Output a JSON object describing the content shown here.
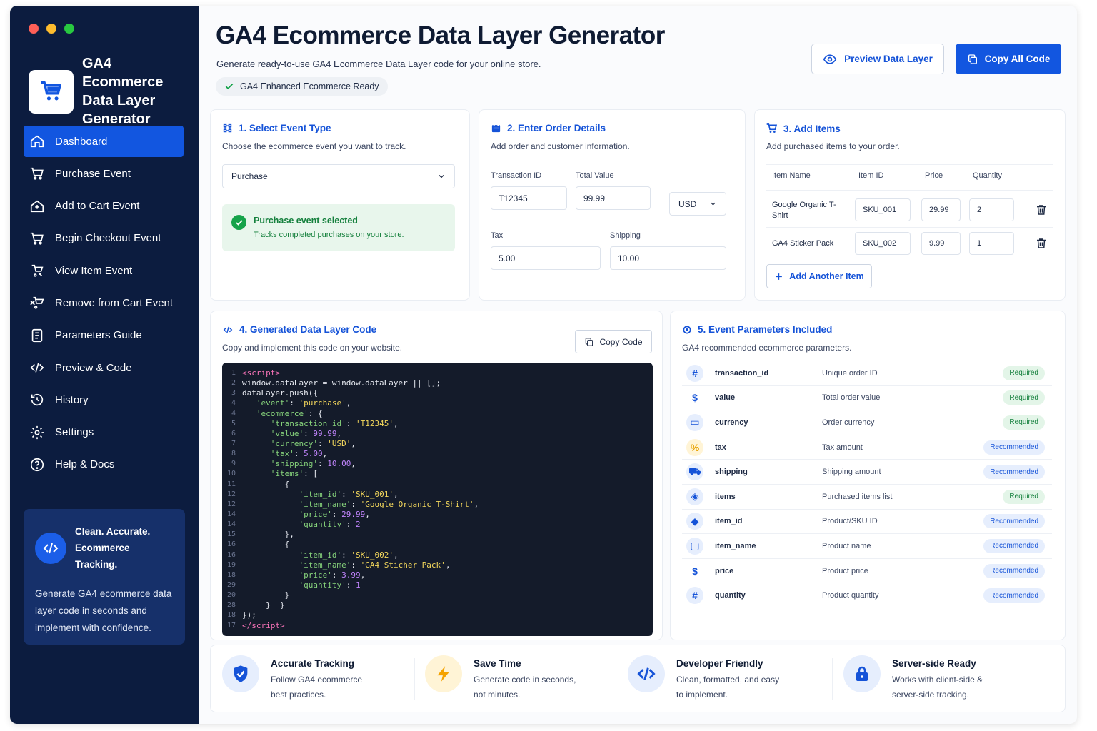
{
  "sidebar": {
    "brand_title": "GA4 Ecommerce Data Layer Generator",
    "items": [
      {
        "label": "Dashboard",
        "icon": "home-icon"
      },
      {
        "label": "Purchase Event",
        "icon": "cart-icon"
      },
      {
        "label": "Add to Cart Event",
        "icon": "add-cart-icon"
      },
      {
        "label": "Begin Checkout Event",
        "icon": "checkout-cart-icon"
      },
      {
        "label": "View Item Event",
        "icon": "view-item-icon"
      },
      {
        "label": "Remove from Cart Event",
        "icon": "remove-cart-icon"
      },
      {
        "label": "Parameters Guide",
        "icon": "guide-icon"
      },
      {
        "label": "Preview & Code",
        "icon": "code-icon"
      },
      {
        "label": "History",
        "icon": "history-icon"
      },
      {
        "label": "Settings",
        "icon": "gear-icon"
      },
      {
        "label": "Help & Docs",
        "icon": "help-icon"
      }
    ],
    "promo": {
      "title": "Clean. Accurate. Ecommerce Tracking.",
      "text": "Generate GA4 ecommerce data layer code in seconds and implement with confidence."
    }
  },
  "header": {
    "title": "GA4 Ecommerce Data Layer Generator",
    "subtitle": "Generate ready-to-use GA4 Ecommerce Data Layer code for your online store.",
    "pill": "GA4 Enhanced Ecommerce Ready",
    "preview_button": "Preview Data Layer",
    "copy_all_button": "Copy All Code"
  },
  "step1": {
    "title": "1. Select Event Type",
    "desc": "Choose the ecommerce event you want to track.",
    "selected": "Purchase",
    "success_title": "Purchase event selected",
    "success_sub": "Tracks completed purchases on your store."
  },
  "step2": {
    "title": "2. Enter Order Details",
    "desc": "Add order and customer information.",
    "transaction_label": "Transaction ID",
    "transaction_value": "T12345",
    "total_label": "Total Value",
    "total_value": "99.99",
    "currency": "USD",
    "tax_label": "Tax",
    "tax_value": "5.00",
    "shipping_label": "Shipping",
    "shipping_value": "10.00"
  },
  "step3": {
    "title": "3. Add Items",
    "desc": "Add purchased items to your order.",
    "columns": [
      "Item Name",
      "Item ID",
      "Price",
      "Quantity"
    ],
    "items": [
      {
        "name": "Google Organic T-Shirt",
        "id": "SKU_001",
        "price": "29.99",
        "qty": "2"
      },
      {
        "name": "GA4 Sticker Pack",
        "id": "SKU_002",
        "price": "9.99",
        "qty": "1"
      }
    ],
    "add_button": "Add Another Item"
  },
  "step4": {
    "title": "4. Generated Data Layer Code",
    "desc": "Copy and implement this code on your website.",
    "copy_button": "Copy Code",
    "code_lines": [
      {
        "n": "1",
        "html": "<span class='tok-tag'>&lt;script&gt;</span>"
      },
      {
        "n": "2",
        "html": "window.dataLayer = window.dataLayer || [];"
      },
      {
        "n": "3",
        "html": "dataLayer.push({"
      },
      {
        "n": "4",
        "html": "   <span class='tok-key'>'event'</span>: <span class='tok-str'>'purchase'</span>,"
      },
      {
        "n": "4",
        "html": "   <span class='tok-key'>'ecommerce'</span>: {"
      },
      {
        "n": "5",
        "html": "      <span class='tok-key'>'transaction_id'</span>: <span class='tok-str'>'T12345'</span>,"
      },
      {
        "n": "6",
        "html": "      <span class='tok-key'>'value'</span>: <span class='tok-num'>99.99</span>,"
      },
      {
        "n": "7",
        "html": "      <span class='tok-key'>'currency'</span>: <span class='tok-str'>'USD'</span>,"
      },
      {
        "n": "8",
        "html": "      <span class='tok-key'>'tax'</span>: <span class='tok-num'>5.00</span>,"
      },
      {
        "n": "9",
        "html": "      <span class='tok-key'>'shipping'</span>: <span class='tok-num'>10.00</span>,"
      },
      {
        "n": "10",
        "html": "      <span class='tok-key'>'items'</span>: ["
      },
      {
        "n": "11",
        "html": "         {"
      },
      {
        "n": "12",
        "html": "            <span class='tok-key'>'item_id'</span>: <span class='tok-str'>'SKU_001'</span>,"
      },
      {
        "n": "12",
        "html": "            <span class='tok-key'>'item_name'</span>: <span class='tok-str'>'Google Organic T-Shirt'</span>,"
      },
      {
        "n": "14",
        "html": "            <span class='tok-key'>'price'</span>: <span class='tok-num'>29.99</span>,"
      },
      {
        "n": "14",
        "html": "            <span class='tok-key'>'quantity'</span>: <span class='tok-num'>2</span>"
      },
      {
        "n": "15",
        "html": "         },"
      },
      {
        "n": "16",
        "html": "         {"
      },
      {
        "n": "16",
        "html": "            <span class='tok-key'>'item_id'</span>: <span class='tok-str'>'SKU_002'</span>,"
      },
      {
        "n": "19",
        "html": "            <span class='tok-key'>'item_name'</span>: <span class='tok-str'>'GA4 Sticher Pack'</span>,"
      },
      {
        "n": "18",
        "html": "            <span class='tok-key'>'price'</span>: <span class='tok-num'>3.99</span>,"
      },
      {
        "n": "29",
        "html": "            <span class='tok-key'>'quantity'</span>: <span class='tok-num'>1</span>"
      },
      {
        "n": "20",
        "html": "         }"
      },
      {
        "n": "28",
        "html": "     }  }"
      },
      {
        "n": "18",
        "html": "});"
      },
      {
        "n": "17",
        "html": "<span class='tok-tag'>&lt;/script&gt;</span>"
      }
    ]
  },
  "step5": {
    "title": "5. Event Parameters Included",
    "desc": "GA4 recommended ecommerce parameters.",
    "params": [
      {
        "icon": "hash-icon",
        "glyph": "#",
        "name": "transaction_id",
        "desc": "Unique order ID",
        "badge": "Required",
        "type": "req",
        "color": "#e6eefd",
        "fg": "#1553d8"
      },
      {
        "icon": "dollar-icon",
        "glyph": "$",
        "name": "value",
        "desc": "Total order value",
        "badge": "Required",
        "type": "req",
        "color": "#ffffff",
        "fg": "#1553d8"
      },
      {
        "icon": "card-icon",
        "glyph": "▭",
        "name": "currency",
        "desc": "Order currency",
        "badge": "Required",
        "type": "req",
        "color": "#e6eefd",
        "fg": "#1553d8"
      },
      {
        "icon": "percent-icon",
        "glyph": "%",
        "name": "tax",
        "desc": "Tax amount",
        "badge": "Recommended",
        "type": "rec",
        "color": "#fff4d6",
        "fg": "#e8a200"
      },
      {
        "icon": "truck-icon",
        "glyph": "⛟",
        "name": "shipping",
        "desc": "Shipping amount",
        "badge": "Recommended",
        "type": "rec",
        "color": "#e6eefd",
        "fg": "#1553d8"
      },
      {
        "icon": "box-icon",
        "glyph": "◈",
        "name": "items",
        "desc": "Purchased items list",
        "badge": "Required",
        "type": "req",
        "color": "#e6eefd",
        "fg": "#1553d8"
      },
      {
        "icon": "tag-icon",
        "glyph": "◆",
        "name": "item_id",
        "desc": "Product/SKU ID",
        "badge": "Recommended",
        "type": "rec",
        "color": "#e6eefd",
        "fg": "#1553d8"
      },
      {
        "icon": "square-icon",
        "glyph": "▢",
        "name": "item_name",
        "desc": "Product name",
        "badge": "Recommended",
        "type": "rec",
        "color": "#e6eefd",
        "fg": "#1553d8"
      },
      {
        "icon": "dollar-icon",
        "glyph": "$",
        "name": "price",
        "desc": "Product price",
        "badge": "Recommended",
        "type": "rec",
        "color": "#ffffff",
        "fg": "#1553d8"
      },
      {
        "icon": "hash-icon",
        "glyph": "#",
        "name": "quantity",
        "desc": "Product quantity",
        "badge": "Recommended",
        "type": "rec",
        "color": "#e6eefd",
        "fg": "#1553d8"
      }
    ]
  },
  "features": [
    {
      "title": "Accurate Tracking",
      "text": "Follow GA4 ecommerce best practices.",
      "icon": "shield-check-icon"
    },
    {
      "title": "Save Time",
      "text": "Generate code in seconds, not minutes.",
      "icon": "lightning-icon"
    },
    {
      "title": "Developer Friendly",
      "text": "Clean, formatted, and easy to implement.",
      "icon": "code-icon"
    },
    {
      "title": "Server-side Ready",
      "text": "Works with client-side & server-side tracking.",
      "icon": "lock-icon"
    }
  ],
  "colors": {
    "accent": "#1256e0",
    "sidebar": "#0c1c3f",
    "success": "#16a34a"
  }
}
